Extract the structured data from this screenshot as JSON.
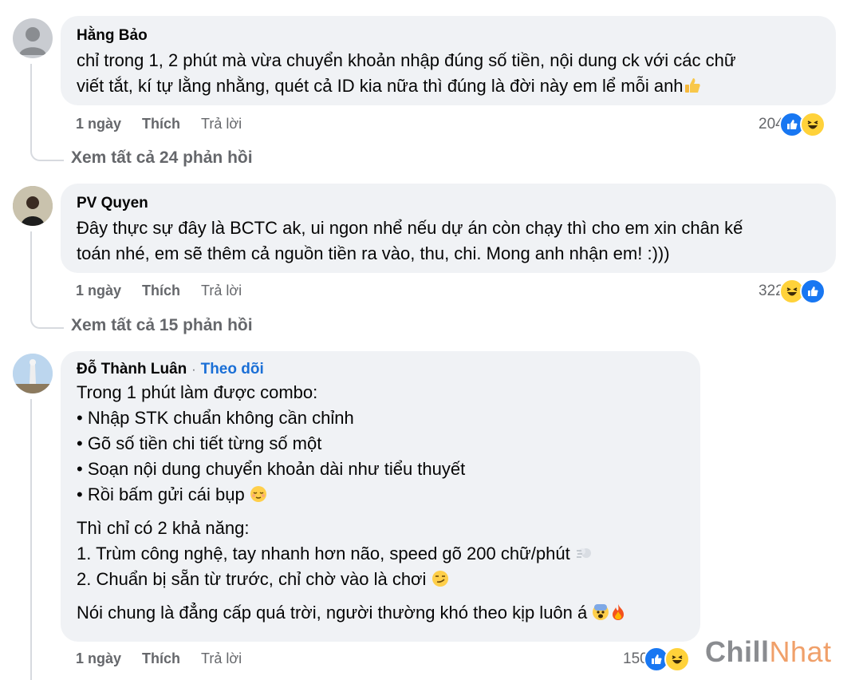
{
  "colors": {
    "bubble": "#f0f2f5",
    "link": "#1a6fd6",
    "muted": "#65676b",
    "like": "#1877f2",
    "haha": "#ffd23a"
  },
  "comments": [
    {
      "author": "Hằng Bảo",
      "lines": [
        "chỉ trong 1, 2 phút mà vừa chuyển khoản nhập đúng số tiền, nội dung ck với các chữ",
        "viết tắt, kí tự lằng nhằng, quét cả ID kia nữa thì đúng là đời này em lể mỗi anh"
      ],
      "trailing_emoji": "thumbs-up-icon",
      "time": "1 ngày",
      "like_label": "Thích",
      "reply_label": "Trả lời",
      "reaction_count": "204",
      "reactions": [
        "like",
        "haha"
      ],
      "view_replies": "Xem tất cả 24 phản hồi"
    },
    {
      "author": "PV Quyen",
      "lines": [
        "Đây thực sự đây là BCTC ak, ui ngon nhể nếu dự án còn chạy thì cho em xin chân kế",
        "toán nhé, em sẽ thêm cả nguồn tiền ra vào, thu, chi. Mong anh nhận em! :)))"
      ],
      "time": "1 ngày",
      "like_label": "Thích",
      "reply_label": "Trả lời",
      "reaction_count": "322",
      "reactions": [
        "haha",
        "like"
      ],
      "view_replies": "Xem tất cả 15 phản hồi"
    },
    {
      "author": "Đỗ Thành Luân",
      "separator": "·",
      "follow_label": "Theo dõi",
      "para1": [
        "Trong 1 phút làm được combo:",
        "• Nhập STK chuẩn không cần chỉnh",
        "• Gõ số tiền chi tiết từng số một",
        "• Soạn nội dung chuyển khoản dài như tiểu thuyết",
        "• Rồi bấm gửi cái bụp"
      ],
      "para2": [
        "Thì chỉ có 2 khả năng:",
        "1. Trùm công nghệ, tay nhanh hơn não, speed gõ 200 chữ/phút",
        "2. Chuẩn bị sẵn từ trước, chỉ chờ vào là chơi"
      ],
      "para3": [
        "Nói chung là đẳng cấp quá trời, người thường khó theo kịp luôn á"
      ],
      "time": "1 ngày",
      "like_label": "Thích",
      "reply_label": "Trả lời",
      "reaction_count": "150",
      "reactions": [
        "like",
        "haha"
      ]
    }
  ],
  "watermark": {
    "part1": "Chill",
    "part2": "Nhat"
  }
}
